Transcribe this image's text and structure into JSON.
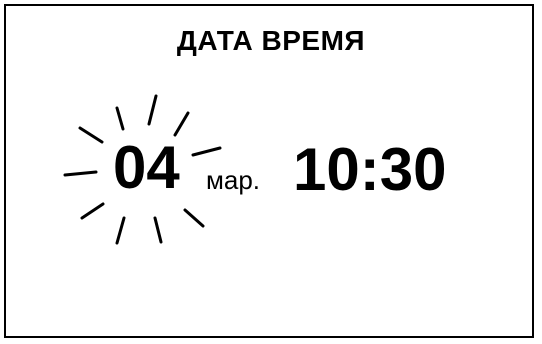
{
  "display": {
    "title": "ДАТА ВРЕМЯ",
    "day": "04",
    "month": "мар.",
    "time": "10:30",
    "blinking_field": "day",
    "blink_indicator_icon": "blink-rays-icon"
  }
}
